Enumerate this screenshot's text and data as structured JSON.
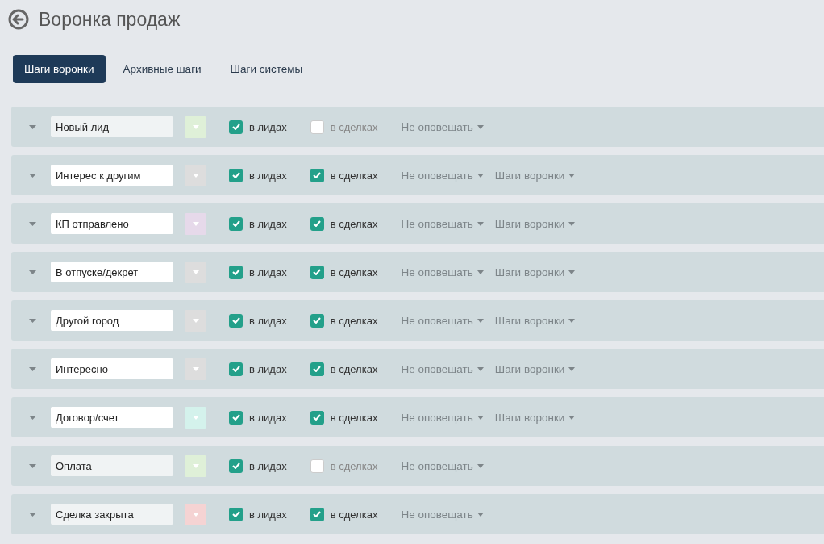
{
  "header": {
    "title": "Воронка продаж"
  },
  "tabs": [
    {
      "label": "Шаги воронки",
      "selected": true
    },
    {
      "label": "Архивные шаги",
      "selected": false
    },
    {
      "label": "Шаги системы",
      "selected": false
    }
  ],
  "stages": [
    {
      "name": "Новый лид",
      "disabled": true,
      "color": "#dff0d8",
      "leads": {
        "label": "в лидах",
        "checked": true
      },
      "deals": {
        "label": "в сделках",
        "checked": false
      },
      "notify": "Не оповещать"
    },
    {
      "name": "Интерес к другим",
      "disabled": false,
      "color": "#dddddd",
      "leads": {
        "label": "в лидах",
        "checked": true
      },
      "deals": {
        "label": "в сделках",
        "checked": true
      },
      "notify": "Не оповещать",
      "funnel": "Шаги воронки"
    },
    {
      "name": "КП отправлено",
      "disabled": false,
      "color": "#e6d9ea",
      "leads": {
        "label": "в лидах",
        "checked": true
      },
      "deals": {
        "label": "в сделках",
        "checked": true
      },
      "notify": "Не оповещать",
      "funnel": "Шаги воронки"
    },
    {
      "name": "В отпуске/декрет",
      "disabled": false,
      "color": "#dddddd",
      "leads": {
        "label": "в лидах",
        "checked": true
      },
      "deals": {
        "label": "в сделках",
        "checked": true
      },
      "notify": "Не оповещать",
      "funnel": "Шаги воронки"
    },
    {
      "name": "Другой город",
      "disabled": false,
      "color": "#dddddd",
      "leads": {
        "label": "в лидах",
        "checked": true
      },
      "deals": {
        "label": "в сделках",
        "checked": true
      },
      "notify": "Не оповещать",
      "funnel": "Шаги воронки"
    },
    {
      "name": "Интересно",
      "disabled": false,
      "color": "#dddddd",
      "leads": {
        "label": "в лидах",
        "checked": true
      },
      "deals": {
        "label": "в сделках",
        "checked": true
      },
      "notify": "Не оповещать",
      "funnel": "Шаги воронки"
    },
    {
      "name": "Договор/счет",
      "disabled": false,
      "color": "#d4f2ec",
      "leads": {
        "label": "в лидах",
        "checked": true
      },
      "deals": {
        "label": "в сделках",
        "checked": true
      },
      "notify": "Не оповещать",
      "funnel": "Шаги воронки"
    },
    {
      "name": "Оплата",
      "disabled": true,
      "color": "#dff0d8",
      "leads": {
        "label": "в лидах",
        "checked": true
      },
      "deals": {
        "label": "в сделках",
        "checked": false
      },
      "notify": "Не оповещать"
    },
    {
      "name": "Сделка закрыта",
      "disabled": true,
      "color": "#f5d3d3",
      "leads": {
        "label": "в лидах",
        "checked": true
      },
      "deals": {
        "label": "в сделках",
        "checked": true
      },
      "notify": "Не оповещать"
    }
  ]
}
